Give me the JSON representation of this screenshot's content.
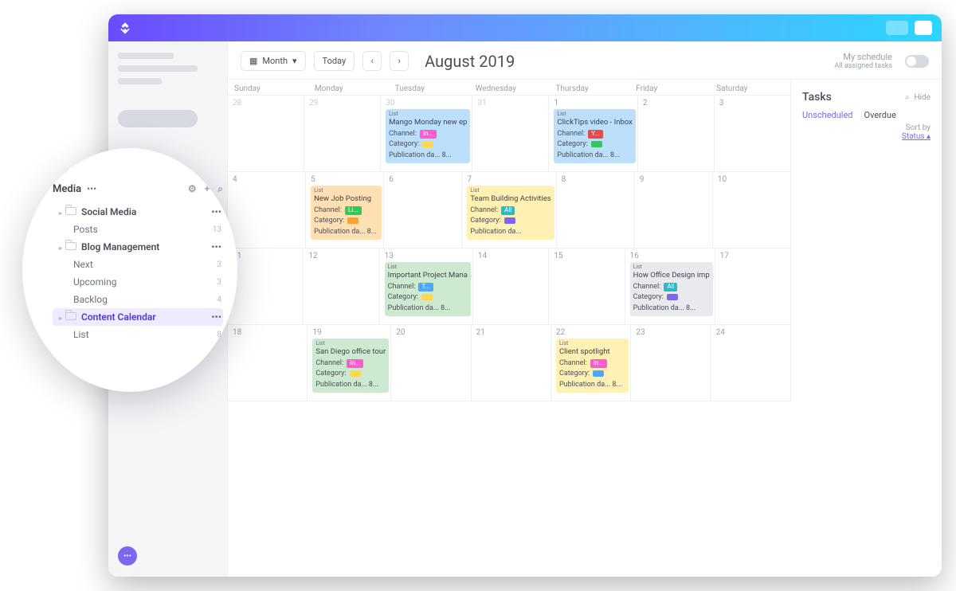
{
  "toolbar": {
    "view_label": "Month",
    "today_label": "Today",
    "title": "August 2019",
    "schedule_label": "My schedule",
    "schedule_sub": "All assigned tasks"
  },
  "daynames": [
    "Sunday",
    "Monday",
    "Tuesday",
    "Wednesday",
    "Thursday",
    "Friday",
    "Saturday"
  ],
  "weeks": [
    {
      "days": [
        {
          "n": "28",
          "muted": true
        },
        {
          "n": "29",
          "muted": true
        },
        {
          "n": "30",
          "muted": true,
          "task": {
            "bg": "bg-blue",
            "list": "List",
            "title": "Mango Monday new ep",
            "channel": {
              "cls": "t-pink",
              "txt": "In..."
            },
            "cat": {
              "cls": "t-yellow"
            },
            "pub": "8..."
          }
        },
        {
          "n": "31",
          "muted": true
        },
        {
          "n": "1",
          "task": {
            "bg": "bg-blue",
            "list": "List",
            "title": "ClickTips video - Inbox",
            "channel": {
              "cls": "t-red",
              "txt": "Y..."
            },
            "cat": {
              "cls": "t-green"
            },
            "pub": "8..."
          }
        },
        {
          "n": "2"
        },
        {
          "n": "3"
        }
      ]
    },
    {
      "days": [
        {
          "n": "4"
        },
        {
          "n": "5",
          "task": {
            "bg": "bg-orange",
            "list": "List",
            "title": "New Job Posting",
            "channel": {
              "cls": "t-green",
              "txt": "Li..."
            },
            "cat": {
              "cls": "t-orange"
            },
            "pub": "8..."
          }
        },
        {
          "n": "6"
        },
        {
          "n": "7",
          "task": {
            "bg": "bg-yellow",
            "list": "List",
            "title": "Team Building Activities",
            "channel": {
              "cls": "t-teal",
              "txt": "All"
            },
            "cat": {
              "cls": "t-purple"
            },
            "pub": ""
          }
        },
        {
          "n": "8"
        },
        {
          "n": "9"
        },
        {
          "n": "10"
        }
      ]
    },
    {
      "days": [
        {
          "n": "11"
        },
        {
          "n": "12"
        },
        {
          "n": "13",
          "task": {
            "bg": "bg-green",
            "list": "List",
            "title": "Important Project Mana",
            "channel": {
              "cls": "t-blue",
              "txt": "T..."
            },
            "cat": {
              "cls": "t-yellow"
            },
            "pub": "8..."
          }
        },
        {
          "n": "14"
        },
        {
          "n": "15"
        },
        {
          "n": "16",
          "task": {
            "bg": "bg-grey",
            "list": "List",
            "title": "How Office Design imp",
            "channel": {
              "cls": "t-teal",
              "txt": "All"
            },
            "cat": {
              "cls": "t-purple"
            },
            "pub": "8..."
          }
        },
        {
          "n": "17"
        }
      ]
    },
    {
      "days": [
        {
          "n": "18"
        },
        {
          "n": "19",
          "task": {
            "bg": "bg-green",
            "list": "List",
            "title": "San Diego office tour",
            "channel": {
              "cls": "t-pink",
              "txt": "In..."
            },
            "cat": {
              "cls": "t-yellow"
            },
            "pub": "8..."
          }
        },
        {
          "n": "20"
        },
        {
          "n": "21"
        },
        {
          "n": "22",
          "task": {
            "bg": "bg-yellow",
            "list": "List",
            "title": "Client spotlight",
            "channel": {
              "cls": "t-pink",
              "txt": "In..."
            },
            "cat": {
              "cls": "t-blue"
            },
            "pub": "8..."
          }
        },
        {
          "n": "23"
        },
        {
          "n": "24"
        }
      ]
    }
  ],
  "labels": {
    "list": "List",
    "channel": "Channel:",
    "category": "Category:",
    "pub": "Publication da..."
  },
  "rside": {
    "title": "Tasks",
    "hide": "Hide",
    "tab1": "Unscheduled",
    "tab2": "Overdue",
    "sort_lbl": "Sort by",
    "sort_val": "Status"
  },
  "pop": {
    "title": "Media",
    "items": [
      {
        "lvl": 1,
        "label": "Social Media",
        "right": "dots"
      },
      {
        "lvl": 2,
        "label": "Posts",
        "right": "13"
      },
      {
        "lvl": 1,
        "label": "Blog Management",
        "right": "dots"
      },
      {
        "lvl": 2,
        "label": "Next",
        "right": "3"
      },
      {
        "lvl": 2,
        "label": "Upcoming",
        "right": "3"
      },
      {
        "lvl": 2,
        "label": "Backlog",
        "right": "4"
      },
      {
        "lvl": 1,
        "label": "Content Calendar",
        "right": "dots",
        "selected": true
      },
      {
        "lvl": 2,
        "label": "List",
        "right": "8"
      }
    ]
  }
}
